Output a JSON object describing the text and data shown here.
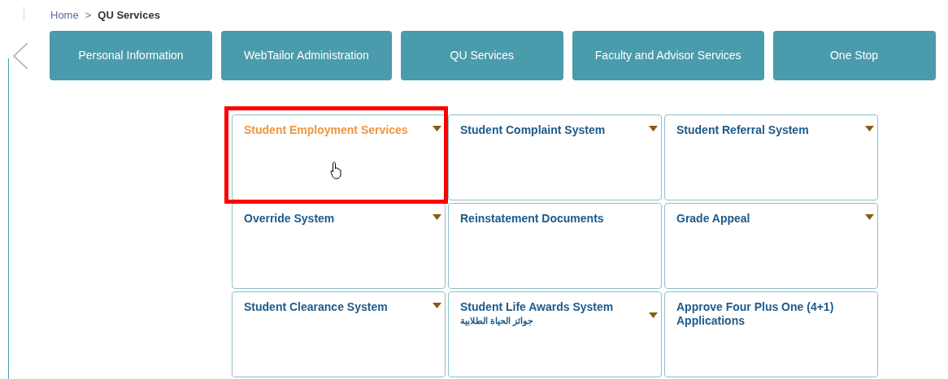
{
  "breadcrumb": {
    "home": "Home",
    "separator": ">",
    "current": "QU Services"
  },
  "tabs": [
    {
      "label": "Personal Information"
    },
    {
      "label": "WebTailor Administration"
    },
    {
      "label": "QU Services"
    },
    {
      "label": "Faculty and Advisor Services"
    },
    {
      "label": "One Stop"
    }
  ],
  "cards": [
    {
      "title": "Student Employment Services",
      "hovered": true,
      "highlighted": true,
      "has_menu": true
    },
    {
      "title": "Student Complaint System",
      "hovered": false,
      "highlighted": false,
      "has_menu": true
    },
    {
      "title": "Student Referral System",
      "hovered": false,
      "highlighted": false,
      "has_menu": true
    },
    {
      "title": "Override System",
      "hovered": false,
      "highlighted": false,
      "has_menu": true
    },
    {
      "title": "Reinstatement Documents",
      "hovered": false,
      "highlighted": false,
      "has_menu": false
    },
    {
      "title": "Grade Appeal",
      "hovered": false,
      "highlighted": false,
      "has_menu": true
    },
    {
      "title": "Student Clearance System",
      "hovered": false,
      "highlighted": false,
      "has_menu": true
    },
    {
      "title": "Student Life Awards System",
      "subtitle": "جوائز الحياة الطلابية",
      "hovered": false,
      "highlighted": false,
      "has_menu": true
    },
    {
      "title": "Approve Four Plus One (4+1) Applications",
      "hovered": false,
      "highlighted": false,
      "has_menu": false
    }
  ]
}
